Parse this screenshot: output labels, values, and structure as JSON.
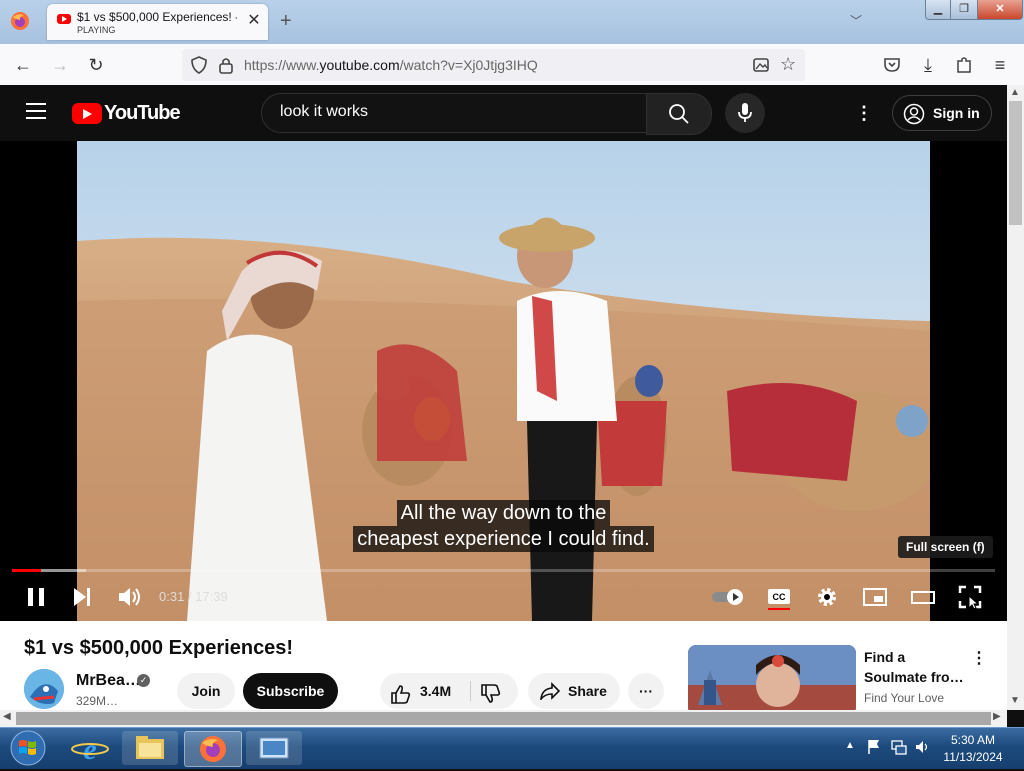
{
  "browser": {
    "tab_title": "$1 vs $500,000 Experiences! - YouTube",
    "tab_status": "PLAYING",
    "url_prefix": "https://www.",
    "url_domain": "youtube.com",
    "url_path": "/watch?v=Xj0Jtjg3IHQ"
  },
  "youtube": {
    "logo_text": "YouTube",
    "search_value": "look it works",
    "sign_in_label": "Sign in"
  },
  "player": {
    "caption_line1": "All the way down to the",
    "caption_line2": "cheapest experience I could find.",
    "tooltip": "Full screen (f)",
    "time_current": "0:31",
    "time_separator": " / ",
    "time_total": "17:39",
    "progress_played": 0.029,
    "progress_buffered": 0.075
  },
  "video": {
    "title": "$1 vs $500,000 Experiences!",
    "channel_name": "MrBea…",
    "subscribers": "329M…",
    "join_label": "Join",
    "subscribe_label": "Subscribe",
    "likes": "3.4M",
    "share_label": "Share"
  },
  "ad": {
    "title": "Find a Soulmate fro…",
    "source": "Find Your Love"
  },
  "taskbar": {
    "time": "5:30 AM",
    "date": "11/13/2024"
  },
  "colors": {
    "brand_red": "#ff0000",
    "yt_bg": "#0f0f0f"
  }
}
